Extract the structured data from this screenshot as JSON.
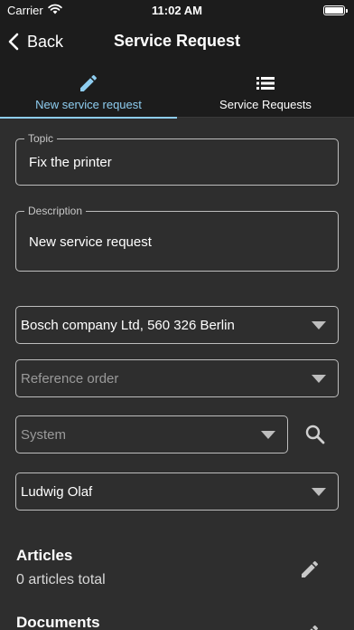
{
  "status_bar": {
    "carrier": "Carrier",
    "time": "11:02 AM"
  },
  "nav": {
    "back_label": "Back",
    "title": "Service Request"
  },
  "tabs": [
    {
      "label": "New service request",
      "icon": "pencil-icon",
      "selected": true
    },
    {
      "label": "Service Requests",
      "icon": "list-icon",
      "selected": false
    }
  ],
  "form": {
    "topic": {
      "legend": "Topic",
      "value": "Fix the printer"
    },
    "description": {
      "legend": "Description",
      "value": "New service request"
    },
    "customer": {
      "value": "Bosch company Ltd, 560 326 Berlin"
    },
    "reference_order": {
      "placeholder": "Reference order"
    },
    "system": {
      "placeholder": "System"
    },
    "contact": {
      "value": "Ludwig Olaf"
    }
  },
  "sections": {
    "articles": {
      "title": "Articles",
      "summary": "0 articles total"
    },
    "documents": {
      "title": "Documents"
    }
  },
  "colors": {
    "accent": "#8ecdf0",
    "background": "#2e2e2e",
    "bar": "#1c1c1c",
    "border": "#bdbdbd"
  }
}
